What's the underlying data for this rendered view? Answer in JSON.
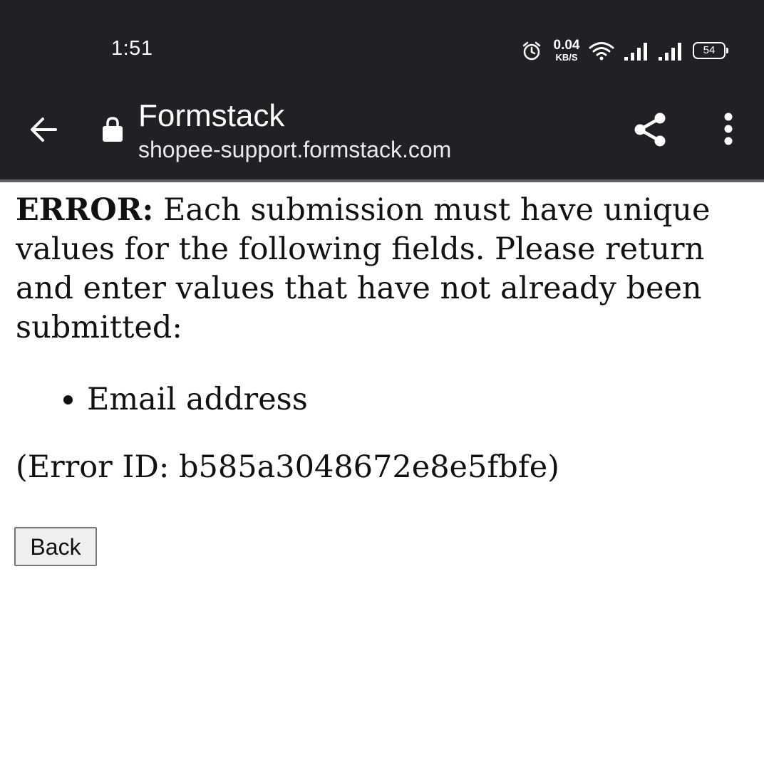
{
  "status_bar": {
    "time": "1:51",
    "net_speed_value": "0.04",
    "net_speed_unit": "KB/S",
    "battery": "54"
  },
  "toolbar": {
    "title": "Formstack",
    "url": "shopee-support.formstack.com"
  },
  "content": {
    "error_label": "ERROR:",
    "error_message": " Each submission must have unique values for the following fields. Please return and enter values that have not already been submitted:",
    "fields": [
      "Email address"
    ],
    "error_id": "(Error ID: b585a3048672e8e5fbfe)",
    "back_label": "Back"
  },
  "icons": {
    "back": "arrow-left-icon",
    "lock": "lock-icon",
    "share": "share-icon",
    "menu": "more-vert-icon",
    "alarm": "alarm-icon",
    "wifi": "wifi-icon",
    "signal": "signal-icon"
  },
  "colors": {
    "toolbar_bg": "#202124",
    "divider": "#5f6368",
    "text": "#111111"
  }
}
